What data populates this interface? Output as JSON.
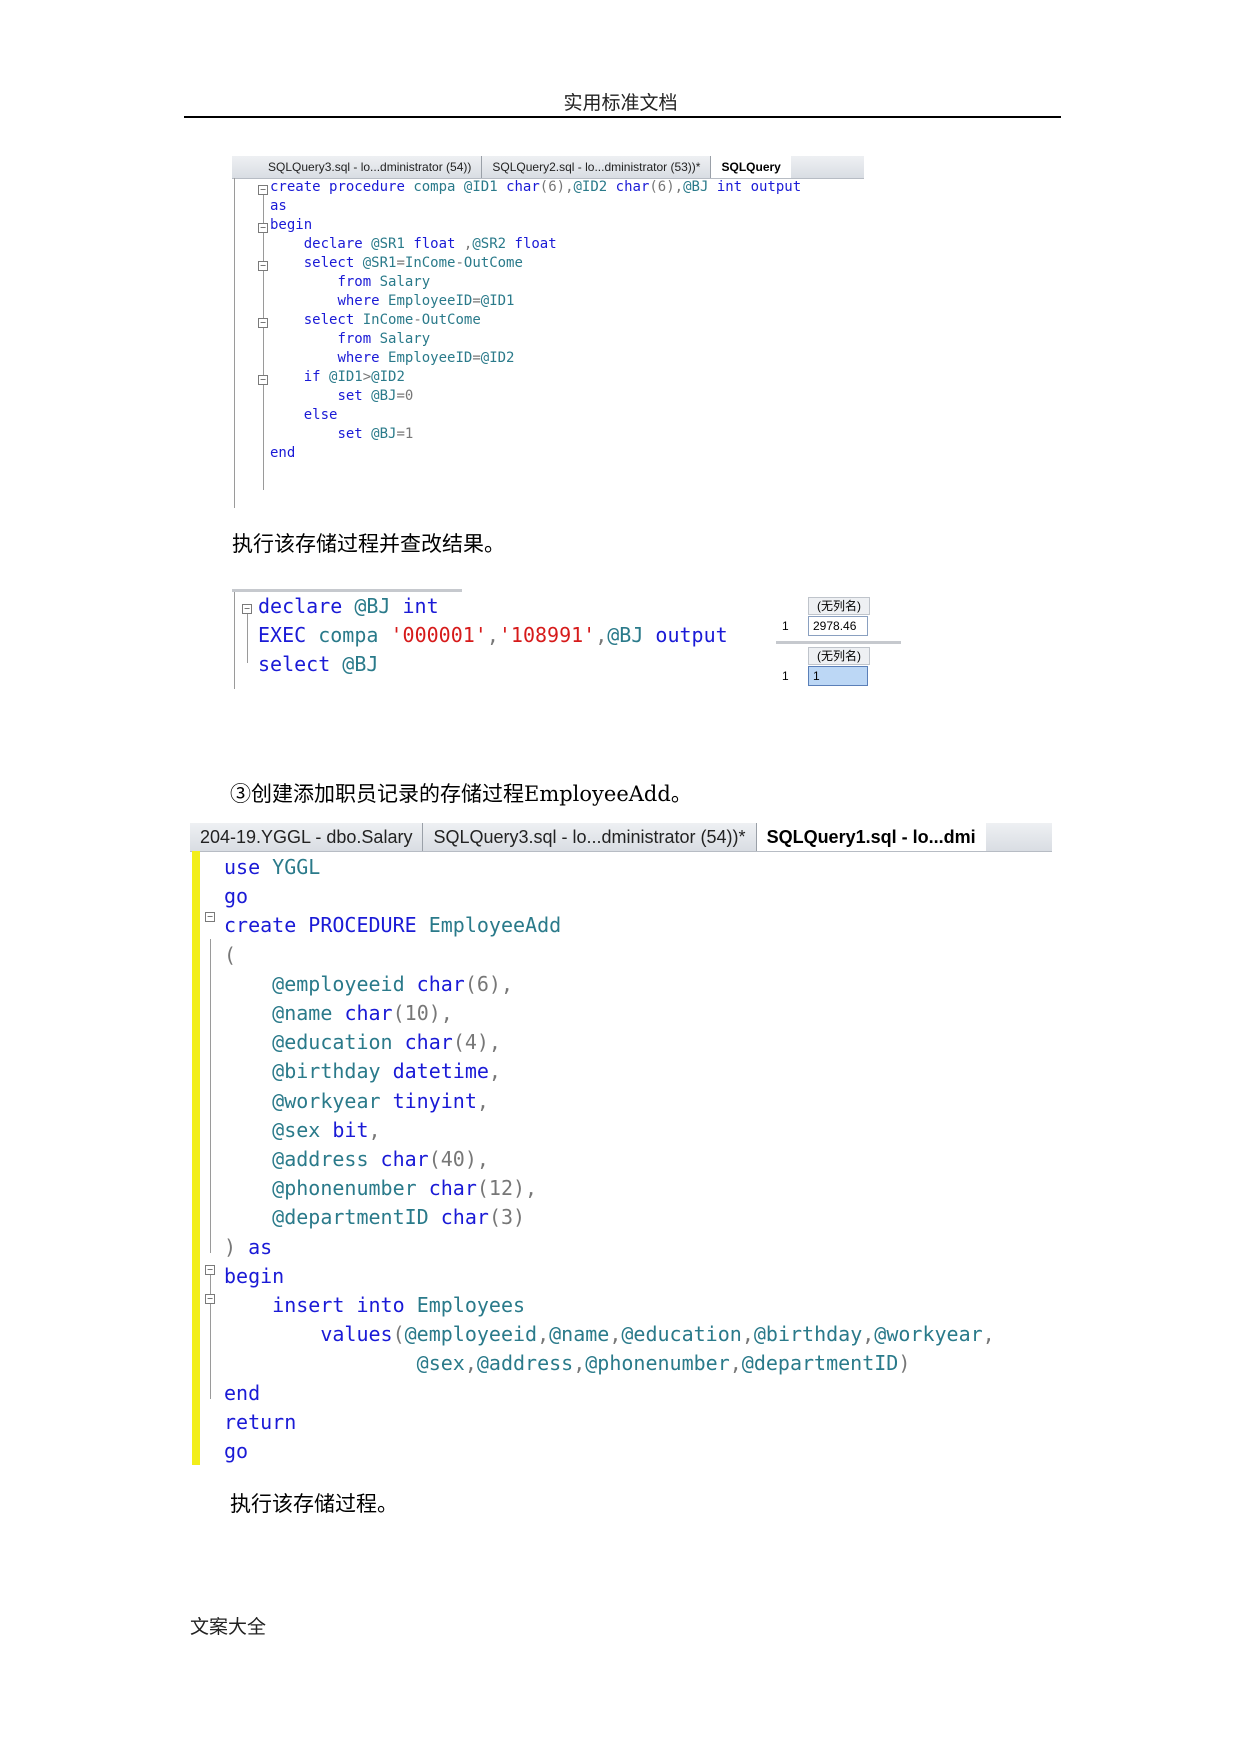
{
  "page": {
    "header": "实用标准文档",
    "footer": "文案大全",
    "para_1": "执行该存储过程并查改结果。",
    "para_2": "③创建添加职员记录的存储过程EmployeeAdd。",
    "para_3": "执行该存储过程。"
  },
  "shot1": {
    "tabs": [
      "SQLQuery3.sql - lo...dministrator (54))",
      "SQLQuery2.sql - lo...dministrator (53))*",
      "SQLQuery"
    ],
    "lines": [
      "create procedure compa @ID1 char(6),@ID2 char(6),@BJ int output",
      "as",
      "begin",
      "    declare @SR1 float ,@SR2 float",
      "    select @SR1=InCome-OutCome",
      "        from Salary",
      "        where EmployeeID=@ID1",
      "    select InCome-OutCome",
      "        from Salary",
      "        where EmployeeID=@ID2",
      "    if @ID1>@ID2",
      "        set @BJ=0",
      "    else",
      "        set @BJ=1",
      "end"
    ]
  },
  "shot2": {
    "lines": [
      "declare @BJ int",
      "EXEC compa '000001','108991',@BJ output",
      "select @BJ"
    ],
    "results": [
      {
        "header": "(无列名)",
        "row": "1",
        "value": "2978.46"
      },
      {
        "header": "(无列名)",
        "row": "1",
        "value": "1"
      }
    ]
  },
  "shot3": {
    "tabs": [
      "204-19.YGGL - dbo.Salary",
      "SQLQuery3.sql - lo...dministrator (54))*",
      "SQLQuery1.sql - lo...dmi"
    ],
    "lines": [
      "use YGGL",
      "go",
      "create PROCEDURE EmployeeAdd",
      "(",
      "    @employeeid char(6),",
      "    @name char(10),",
      "    @education char(4),",
      "    @birthday datetime,",
      "    @workyear tinyint,",
      "    @sex bit,",
      "    @address char(40),",
      "    @phonenumber char(12),",
      "    @departmentID char(3)",
      ") as",
      "begin",
      "    insert into Employees",
      "        values(@employeeid,@name,@education,@birthday,@workyear,",
      "                @sex,@address,@phonenumber,@departmentID)",
      "end",
      "return",
      "go"
    ]
  },
  "colors": {
    "keyword": "#1a1ad6",
    "string": "#d61a1a",
    "identifier": "#2a7a8a",
    "change_bar": "#f2ee1a"
  },
  "icons": [
    "fold-minus-icon"
  ]
}
